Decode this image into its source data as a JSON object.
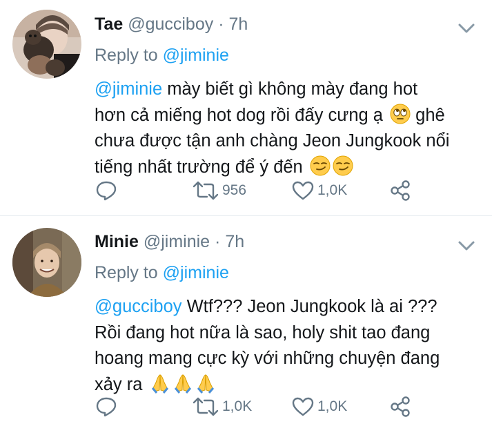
{
  "tweets": [
    {
      "name": "Tae",
      "handle": "@gucciboy",
      "separator": "·",
      "time": "7h",
      "reply_prefix": "Reply to",
      "reply_to": "@jiminie",
      "text_mention": "@jiminie",
      "text_line1_rest": " mày biết gì không mày đang hot",
      "text_line2": "hơn cả miếng hot dog rồi đấy cưng ạ",
      "text_line2_end": "ghê",
      "text_line3": "chưa được tận anh chàng Jeon Jungkook nổi",
      "text_line4": "tiếng nhất trường để ý đến",
      "retweets": "956",
      "likes": "1,0K",
      "emoji_line2": "rolling-eyes-emoji",
      "emoji_line4": [
        "smirk-emoji",
        "smirk-emoji"
      ]
    },
    {
      "name": "Minie",
      "handle": "@jiminie",
      "separator": "·",
      "time": "7h",
      "reply_prefix": "Reply to",
      "reply_to": "@jiminie",
      "text_mention": "@gucciboy",
      "text_line1_rest": " Wtf??? Jeon Jungkook là ai ???",
      "text_line2": "Rồi đang hot nữa là sao, holy shit tao đang",
      "text_line3": "hoang mang cực kỳ với những chuyện đang",
      "text_line4": "xảy ra",
      "retweets": "1,0K",
      "likes": "1,0K",
      "emoji_line4": [
        "folded-hands-emoji",
        "folded-hands-emoji",
        "folded-hands-emoji"
      ]
    }
  ],
  "colors": {
    "link": "#1da1f2",
    "secondary": "#657786",
    "text": "#14171a",
    "divider": "#e6ecf0"
  }
}
